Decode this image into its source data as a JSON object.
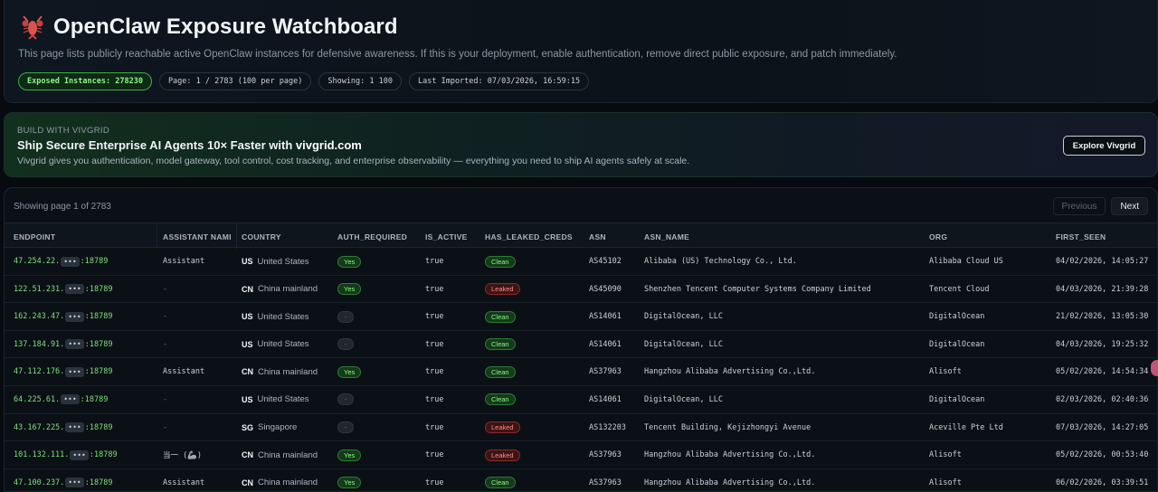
{
  "header": {
    "title": "OpenClaw Exposure Watchboard",
    "subtitle": "This page lists publicly reachable active OpenClaw instances for defensive awareness. If this is your deployment, enable authentication, remove direct public exposure, and patch immediately.",
    "badges": {
      "exposed": "Exposed Instances: 278230",
      "page": "Page: 1 / 2783 (100 per page)",
      "showing": "Showing: 1 100",
      "imported": "Last Imported: 07/03/2026, 16:59:15"
    }
  },
  "promo": {
    "tag": "BUILD WITH VIVGRID",
    "title_prefix": "Ship Secure Enterprise AI Agents 10× Faster with ",
    "title_link": "vivgrid.com",
    "text": "Vivgrid gives you authentication, model gateway, tool control, cost tracking, and enterprise observability — everything you need to ship AI agents safely at scale.",
    "button": "Explore Vivgrid"
  },
  "table": {
    "showing_label": "Showing page 1 of 2783",
    "prev_label": "Previous",
    "next_label": "Next",
    "columns": [
      "ENDPOINT",
      "ASSISTANT NAMI",
      "COUNTRY",
      "AUTH_REQUIRED",
      "IS_ACTIVE",
      "HAS_LEAKED_CREDS",
      "ASN",
      "ASN_NAME",
      "ORG",
      "FIRST_SEEN"
    ],
    "mask": "•••",
    "rows": [
      {
        "ip_prefix": "47.254.22.",
        "port": ":18789",
        "assistant": "Assistant",
        "cc": "US",
        "country": "United States",
        "auth": "Yes",
        "active": "true",
        "leaked": "Clean",
        "asn": "AS45102",
        "asn_name": "Alibaba (US) Technology Co., Ltd.",
        "org": "Alibaba Cloud US",
        "first_seen": "04/02/2026, 14:05:27"
      },
      {
        "ip_prefix": "122.51.231.",
        "port": ":18789",
        "assistant": "-",
        "cc": "CN",
        "country": "China mainland",
        "auth": "Yes",
        "active": "true",
        "leaked": "Leaked",
        "asn": "AS45090",
        "asn_name": "Shenzhen Tencent Computer Systems Company Limited",
        "org": "Tencent Cloud",
        "first_seen": "04/03/2026, 21:39:28"
      },
      {
        "ip_prefix": "162.243.47.",
        "port": ":18789",
        "assistant": "-",
        "cc": "US",
        "country": "United States",
        "auth": "-",
        "active": "true",
        "leaked": "Clean",
        "asn": "AS14061",
        "asn_name": "DigitalOcean, LLC",
        "org": "DigitalOcean",
        "first_seen": "21/02/2026, 13:05:30"
      },
      {
        "ip_prefix": "137.184.91.",
        "port": ":18789",
        "assistant": "-",
        "cc": "US",
        "country": "United States",
        "auth": "-",
        "active": "true",
        "leaked": "Clean",
        "asn": "AS14061",
        "asn_name": "DigitalOcean, LLC",
        "org": "DigitalOcean",
        "first_seen": "04/03/2026, 19:25:32"
      },
      {
        "ip_prefix": "47.112.176.",
        "port": ":18789",
        "assistant": "Assistant",
        "cc": "CN",
        "country": "China mainland",
        "auth": "Yes",
        "active": "true",
        "leaked": "Clean",
        "asn": "AS37963",
        "asn_name": "Hangzhou Alibaba Advertising Co.,Ltd.",
        "org": "Alisoft",
        "first_seen": "05/02/2026, 14:54:34"
      },
      {
        "ip_prefix": "64.225.61.",
        "port": ":18789",
        "assistant": "-",
        "cc": "US",
        "country": "United States",
        "auth": "-",
        "active": "true",
        "leaked": "Clean",
        "asn": "AS14061",
        "asn_name": "DigitalOcean, LLC",
        "org": "DigitalOcean",
        "first_seen": "02/03/2026, 02:40:36"
      },
      {
        "ip_prefix": "43.167.225.",
        "port": ":18789",
        "assistant": "-",
        "cc": "SG",
        "country": "Singapore",
        "auth": "-",
        "active": "true",
        "leaked": "Leaked",
        "asn": "AS132203",
        "asn_name": "Tencent Building, Kejizhongyi Avenue",
        "org": "Aceville Pte Ltd",
        "first_seen": "07/03/2026, 14:27:05"
      },
      {
        "ip_prefix": "101.132.111.",
        "port": ":18789",
        "assistant": "当一 (🦾)",
        "cc": "CN",
        "country": "China mainland",
        "auth": "Yes",
        "active": "true",
        "leaked": "Leaked",
        "asn": "AS37963",
        "asn_name": "Hangzhou Alibaba Advertising Co.,Ltd.",
        "org": "Alisoft",
        "first_seen": "05/02/2026, 00:53:40"
      },
      {
        "ip_prefix": "47.100.237.",
        "port": ":18789",
        "assistant": "Assistant",
        "cc": "CN",
        "country": "China mainland",
        "auth": "Yes",
        "active": "true",
        "leaked": "Clean",
        "asn": "AS37963",
        "asn_name": "Hangzhou Alibaba Advertising Co.,Ltd.",
        "org": "Alisoft",
        "first_seen": "06/02/2026, 03:39:51"
      }
    ]
  }
}
